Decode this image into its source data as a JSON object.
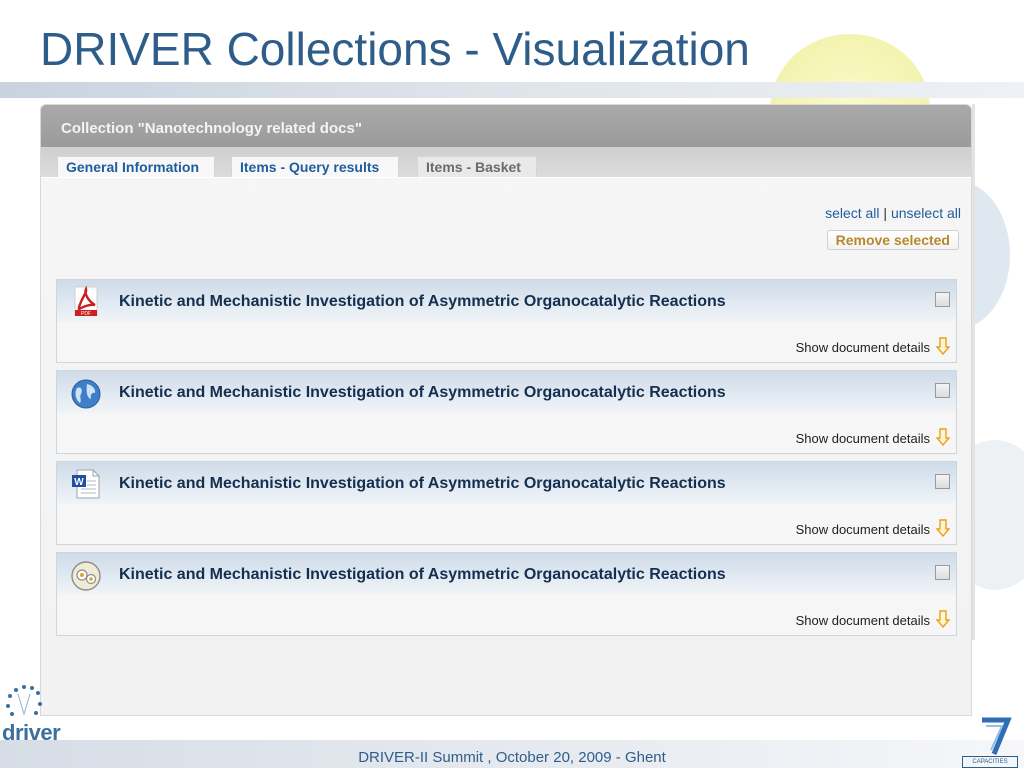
{
  "slide": {
    "title": "DRIVER Collections - Visualization",
    "footer": "DRIVER-II Summit , October 20, 2009 - Ghent",
    "logo_left_text": "driver",
    "logo_right_caption": "CAPACITIES"
  },
  "window": {
    "title": "Collection \"Nanotechnology related docs\"",
    "tabs": [
      {
        "label": "General Information"
      },
      {
        "label": "Items - Query results"
      },
      {
        "label": "Items - Basket"
      }
    ],
    "select_all": "select all",
    "separator": "|",
    "unselect_all": "unselect all",
    "remove_selected": "Remove selected"
  },
  "items": [
    {
      "icon": "pdf-icon",
      "title": "Kinetic and Mechanistic Investigation of Asymmetric Organocatalytic Reactions",
      "details": "Show document details",
      "checked": false
    },
    {
      "icon": "globe-icon",
      "title": "Kinetic and Mechanistic Investigation of Asymmetric Organocatalytic Reactions",
      "details": "Show document details",
      "checked": false
    },
    {
      "icon": "word-document-icon",
      "title": "Kinetic and Mechanistic Investigation of Asymmetric Organocatalytic Reactions",
      "details": "Show document details",
      "checked": false
    },
    {
      "icon": "media-disc-icon",
      "title": "Kinetic and Mechanistic Investigation of Asymmetric Organocatalytic Reactions",
      "details": "Show document details",
      "checked": false
    }
  ],
  "colors": {
    "title_blue": "#2f5d8a",
    "link_blue": "#1f5d9b",
    "item_title": "#142f4f",
    "remove_text": "#b8892a",
    "arrow_orange": "#e8a21a"
  }
}
